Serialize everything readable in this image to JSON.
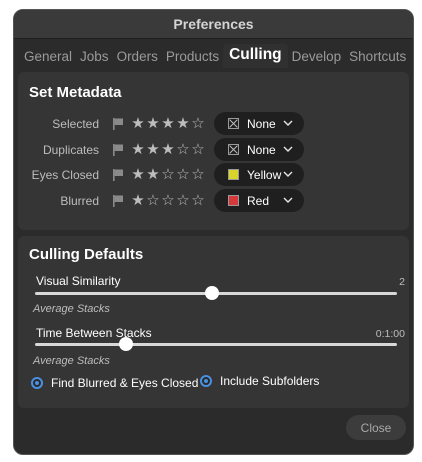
{
  "window": {
    "title": "Preferences"
  },
  "tabs": [
    "General",
    "Jobs",
    "Orders",
    "Products",
    "Culling",
    "Develop",
    "Shortcuts"
  ],
  "active_tab": "Culling",
  "set_metadata": {
    "title": "Set Metadata",
    "rows": [
      {
        "label": "Selected",
        "rating": 4,
        "color_label": "None",
        "color": null
      },
      {
        "label": "Duplicates",
        "rating": 3,
        "color_label": "None",
        "color": null
      },
      {
        "label": "Eyes Closed",
        "rating": 2,
        "color_label": "Yellow",
        "color": "#d8d42a"
      },
      {
        "label": "Blurred",
        "rating": 1,
        "color_label": "Red",
        "color": "#d6393c"
      }
    ]
  },
  "culling_defaults": {
    "title": "Culling Defaults",
    "visual_similarity": {
      "label": "Visual Similarity",
      "value": "2",
      "sub_label": "Average Stacks",
      "position": 0.49
    },
    "time_between_stacks": {
      "label": "Time Between Stacks",
      "value": "0:1:00",
      "sub_label": "Average Stacks",
      "position": 0.25
    },
    "options": [
      {
        "label": "Find Blurred & Eyes Closed",
        "checked": true
      },
      {
        "label": "Include Subfolders",
        "checked": true
      }
    ]
  },
  "footer": {
    "close_label": "Close"
  },
  "colors": {
    "accent": "#4a90e2",
    "background": "#2b2b2b",
    "panel": "#353535"
  },
  "icons": {
    "flag": "flag-icon",
    "star": "star-icon",
    "chevron": "chevron-down-icon",
    "radio": "radio-icon"
  }
}
